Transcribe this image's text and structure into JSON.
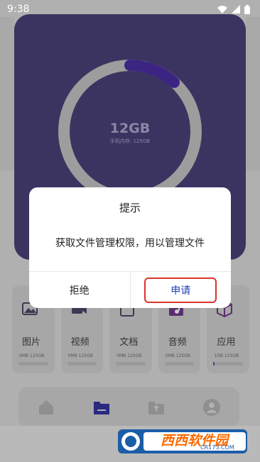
{
  "status_bar": {
    "time": "9:38"
  },
  "storage": {
    "total": "12GB",
    "detail": "手机内存: 125GB"
  },
  "categories": [
    {
      "name": "图片",
      "size": "0MB     125GB",
      "fill": 0
    },
    {
      "name": "视频",
      "size": "0MB     125GB",
      "fill": 0
    },
    {
      "name": "文档",
      "size": "0MB     125GB",
      "fill": 0
    },
    {
      "name": "音频",
      "size": "0MB     125GB",
      "fill": 0
    },
    {
      "name": "应用",
      "size": "1GB     125GB",
      "fill": 0.03
    }
  ],
  "dialog": {
    "title": "提示",
    "message": "获取文件管理权限，用以管理文件",
    "reject_label": "拒绝",
    "apply_label": "申请"
  },
  "watermark": {
    "text": "西西软件园",
    "sub": "CR173.COM"
  },
  "colors": {
    "accent": "#3b3461",
    "ring": "#4b2f99",
    "apply_text": "#1e3fb0",
    "highlight_border": "#d9342b"
  }
}
